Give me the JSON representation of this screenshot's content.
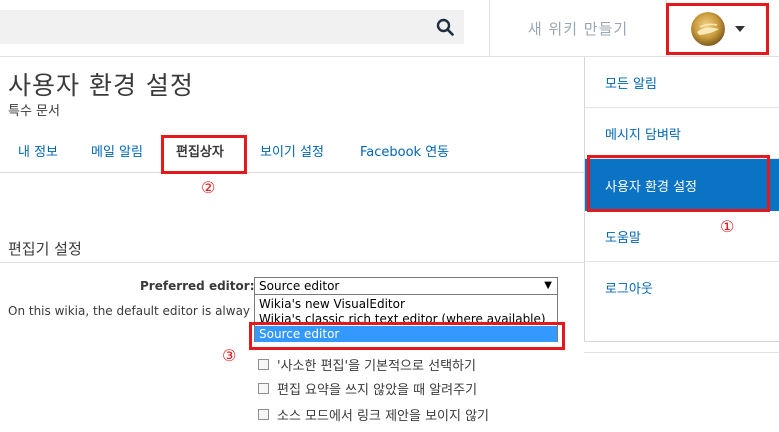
{
  "header": {
    "search_icon": "search-icon",
    "create_wiki_label": "새 위키 만들기",
    "user_caret_icon": "caret-down-icon"
  },
  "page": {
    "title": "사용자 환경 설정",
    "subtitle": "특수 문서"
  },
  "tabs": [
    {
      "label": "내 정보"
    },
    {
      "label": "메일 알림"
    },
    {
      "label": "편집상자",
      "active": true
    },
    {
      "label": "보이기 설정"
    },
    {
      "label": "Facebook 연동"
    }
  ],
  "editor_section": {
    "title": "편집기 설정",
    "preferred_label": "Preferred editor:",
    "selected_value": "Source editor",
    "options": [
      "Wikia's new VisualEditor",
      "Wikia's classic rich text editor (where available)",
      "Source editor"
    ],
    "default_note": "On this wikia, the default editor is alway",
    "checkboxes": [
      {
        "label": "'사소한 편집'을 기본적으로 선택하기",
        "checked": false
      },
      {
        "label": "편집 요약을 쓰지 않았을 때 알려주기",
        "checked": false
      },
      {
        "label": "소스 모드에서 링크 제안을 보이지 않기",
        "checked": false
      }
    ]
  },
  "user_menu": {
    "items": [
      {
        "label": "모든 알림"
      },
      {
        "label": "메시지 담벼락"
      },
      {
        "label": "사용자 환경 설정",
        "active": true
      },
      {
        "label": "도움말"
      },
      {
        "label": "로그아웃"
      }
    ]
  },
  "annotations": {
    "marker_1": "①",
    "marker_2": "②",
    "marker_3": "③"
  },
  "colors": {
    "accent": "#0b73c4",
    "link": "#0066b5",
    "highlight": "#e3191b",
    "selection": "#3399ff"
  }
}
